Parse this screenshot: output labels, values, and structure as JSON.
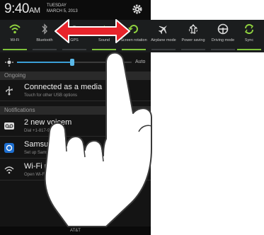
{
  "status_bar": {
    "time": "9:40",
    "am_pm": "AM",
    "day": "TUESDAY",
    "date": "MARCH 5, 2013"
  },
  "quick_settings": [
    {
      "label": "Wi-Fi",
      "icon": "wifi-icon",
      "on": true
    },
    {
      "label": "Bluetooth",
      "icon": "bluetooth-icon",
      "on": false
    },
    {
      "label": "GPS",
      "icon": "gps-icon",
      "on": false
    },
    {
      "label": "Sound",
      "icon": "sound-icon",
      "on": true
    },
    {
      "label": "Screen rotation",
      "icon": "screen-rotation-icon",
      "on": true
    },
    {
      "label": "Airplane mode",
      "icon": "airplane-icon",
      "on": false
    },
    {
      "label": "Power saving",
      "icon": "power-saving-icon",
      "on": false
    },
    {
      "label": "Driving mode",
      "icon": "driving-mode-icon",
      "on": false
    },
    {
      "label": "Sync",
      "icon": "sync-icon",
      "on": true
    }
  ],
  "brightness": {
    "auto_label": "Auto",
    "level": 0.48
  },
  "sections": {
    "ongoing": "Ongoing",
    "notifications": "Notifications"
  },
  "ongoing": [
    {
      "title": "Connected as a media",
      "subtitle": "Touch for other USB options",
      "icon": "usb-icon"
    }
  ],
  "notifications": [
    {
      "title": "2 new voicem",
      "subtitle": "Dial +1-817-999",
      "icon": "voicemail-icon"
    },
    {
      "title": "Samsung ",
      "subtitle": "Set up Samsung",
      "icon": "samsung-account-icon"
    },
    {
      "title": "Wi-Fi ne",
      "subtitle": "Open Wi-Fi",
      "icon": "wifi-network-icon"
    }
  ],
  "carrier": "AT&T",
  "colors": {
    "active_indicator": "#7ec23a",
    "arrow": "#e8242b",
    "accent": "#3b9fd6"
  },
  "gesture": {
    "type": "swipe",
    "direction": "horizontal",
    "overlay": "hand-icon"
  }
}
